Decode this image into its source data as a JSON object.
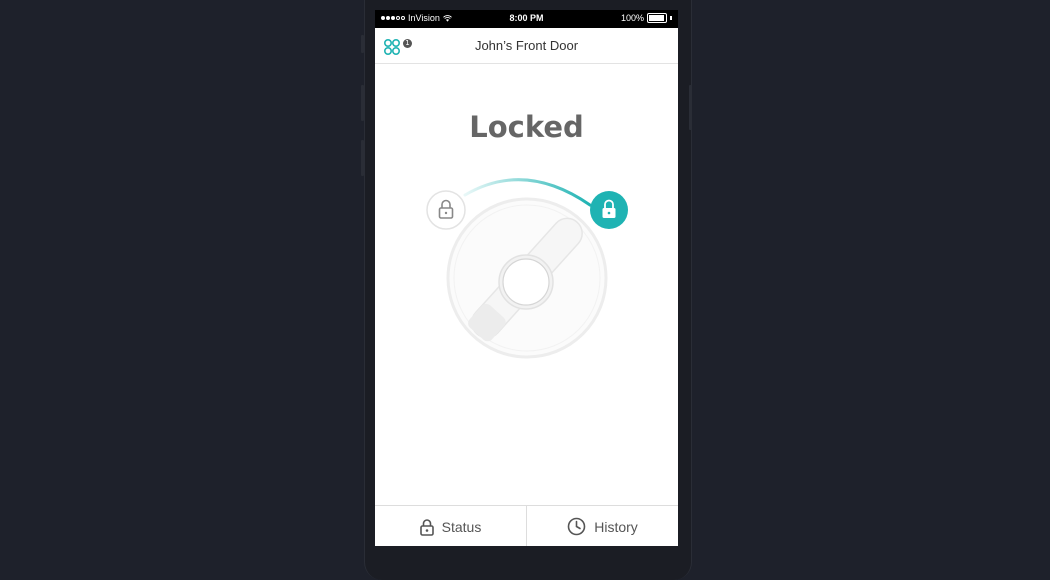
{
  "status_bar": {
    "carrier": "InVision",
    "time": "8:00 PM",
    "battery": "100%"
  },
  "nav": {
    "title": "John’s Front Door",
    "menu_icon": "grid-icon",
    "badge_count": "1"
  },
  "lock": {
    "state": "Locked",
    "unlocked_icon": "unlock-icon",
    "locked_icon": "lock-icon",
    "accent_color": "#1fb3b3"
  },
  "tabs": [
    {
      "label": "Status",
      "icon": "lock-icon"
    },
    {
      "label": "History",
      "icon": "clock-icon"
    }
  ]
}
